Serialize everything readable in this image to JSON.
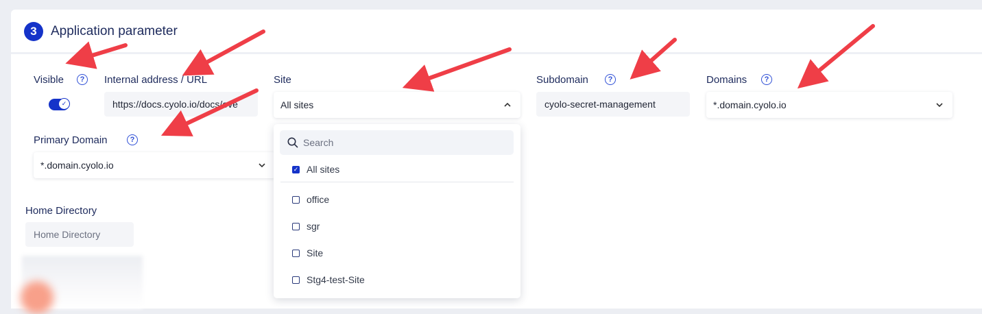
{
  "section": {
    "number": "3",
    "title": "Application parameter"
  },
  "fields": {
    "visible": {
      "label": "Visible",
      "enabled": true
    },
    "internal_address": {
      "label": "Internal address / URL",
      "value": "https://docs.cyolo.io/docs/ove"
    },
    "site": {
      "label": "Site",
      "value": "All sites"
    },
    "subdomain": {
      "label": "Subdomain",
      "value": "cyolo-secret-management"
    },
    "domains": {
      "label": "Domains",
      "value": "*.domain.cyolo.io"
    },
    "primary_domain": {
      "label": "Primary Domain",
      "value": "*.domain.cyolo.io"
    },
    "home_directory": {
      "label": "Home Directory",
      "placeholder": "Home Directory"
    }
  },
  "site_dropdown": {
    "search_placeholder": "Search",
    "options": [
      {
        "label": "All sites",
        "checked": true
      },
      {
        "label": "office",
        "checked": false
      },
      {
        "label": "sgr",
        "checked": false
      },
      {
        "label": "Site",
        "checked": false
      },
      {
        "label": "Stg4-test-Site",
        "checked": false
      }
    ]
  },
  "help_glyph": "?",
  "icons": {
    "chevron_down": "chevron-down-icon",
    "chevron_up": "chevron-up-icon",
    "search": "search-icon",
    "help": "question-circle-icon",
    "check": "check-icon"
  },
  "colors": {
    "accent": "#1533c9",
    "annotation_arrow": "#ef3e47",
    "label": "#1d2a5c"
  }
}
